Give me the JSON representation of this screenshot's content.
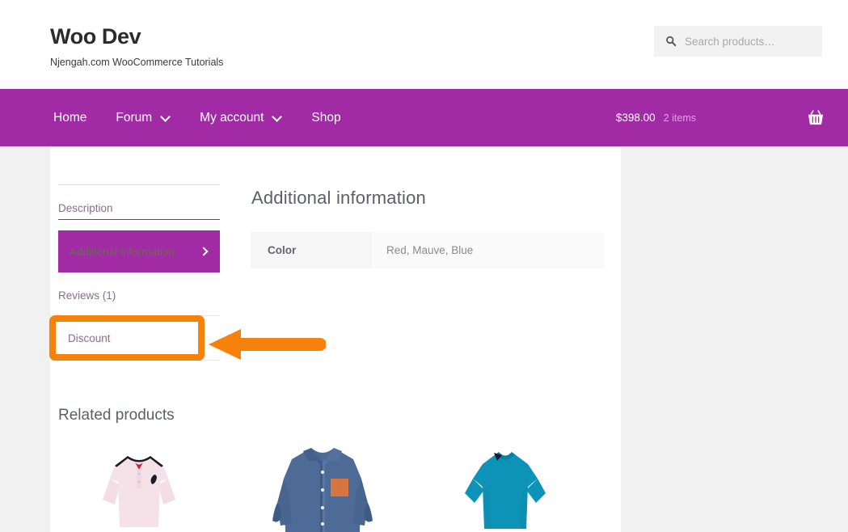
{
  "site": {
    "brand_title": "Woo Dev",
    "brand_tagline": "Njengah.com WooCommerce Tutorials"
  },
  "search": {
    "placeholder": "Search products…",
    "icon": "search-icon"
  },
  "nav": {
    "items": [
      {
        "label": "Home",
        "has_dropdown": false
      },
      {
        "label": "Forum",
        "has_dropdown": true
      },
      {
        "label": "My account",
        "has_dropdown": true
      },
      {
        "label": "Shop",
        "has_dropdown": false
      }
    ],
    "cart": {
      "amount": "$398.00",
      "count": "2 items",
      "icon": "shopping-basket-icon"
    },
    "background_color": "#a12ba4"
  },
  "product_tabs": {
    "items": [
      {
        "label": "Description",
        "active": false
      },
      {
        "label": "Additional information",
        "active": true
      },
      {
        "label": "Reviews (1)",
        "active": false
      },
      {
        "label": "Discount",
        "active": false
      }
    ],
    "active_background": "#a12ba4",
    "link_color": "#8c6b8f"
  },
  "panel": {
    "title": "Additional information",
    "attributes": [
      {
        "name": "Color",
        "value": "Red, Mauve, Blue"
      }
    ]
  },
  "related": {
    "title": "Related products",
    "products": [
      {
        "alt": "pink polo shirt",
        "color": "#f3e0e6"
      },
      {
        "alt": "blue button-up shirt",
        "color": "#4f6c99"
      },
      {
        "alt": "teal t-shirt",
        "color": "#0d93b8"
      }
    ]
  },
  "annotation": {
    "color": "#F7820B",
    "target_label": "Discount",
    "box": "highlight-box",
    "arrow": "pointer-arrow-left"
  }
}
